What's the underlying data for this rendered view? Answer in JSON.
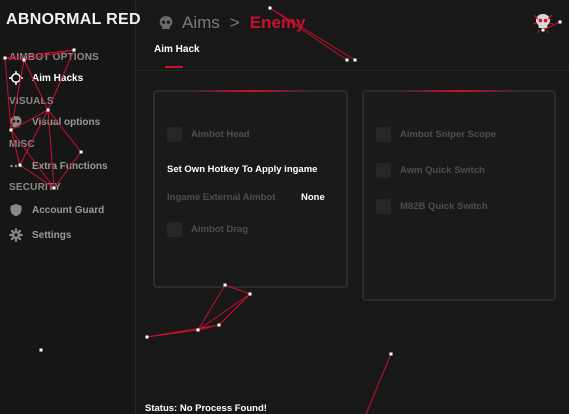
{
  "app": {
    "title": "ABNORMAL RED"
  },
  "sidebar": {
    "sections": {
      "aimbot": "AIMBOT OPTIONS",
      "visuals": "VISUALS",
      "misc": "MISC",
      "security": "SECURITY"
    },
    "items": [
      {
        "label": "Aim Hacks",
        "icon": "crosshair-icon",
        "active": true
      },
      {
        "label": "Visual options",
        "icon": "skull-icon"
      },
      {
        "label": "Extra Functions",
        "icon": "ellipsis-icon"
      },
      {
        "label": "Account Guard",
        "icon": "shield-icon"
      },
      {
        "label": "Settings",
        "icon": "gear-icon"
      }
    ]
  },
  "header": {
    "icon": "skull-icon",
    "crumb_parent": "Aims",
    "crumb_separator": ">",
    "crumb_current": "Enemy",
    "tab": "Aim Hack"
  },
  "panel_left": {
    "options": [
      "Aimbot Head",
      "Aimbot Drag"
    ],
    "hotkey_title": "Set Own Hotkey To Apply ingame",
    "hotkey_label": "Ingame External Aimbot",
    "hotkey_value": "None"
  },
  "panel_right": {
    "options": [
      "Aimbot Sniper Scope",
      "Awm Quick Switch",
      "M82B Quick Switch"
    ]
  },
  "status": {
    "text": "Status: No Process Found!"
  },
  "colors": {
    "accent": "#c8102e",
    "background": "#181818",
    "text_dim": "#4e4e4e"
  }
}
